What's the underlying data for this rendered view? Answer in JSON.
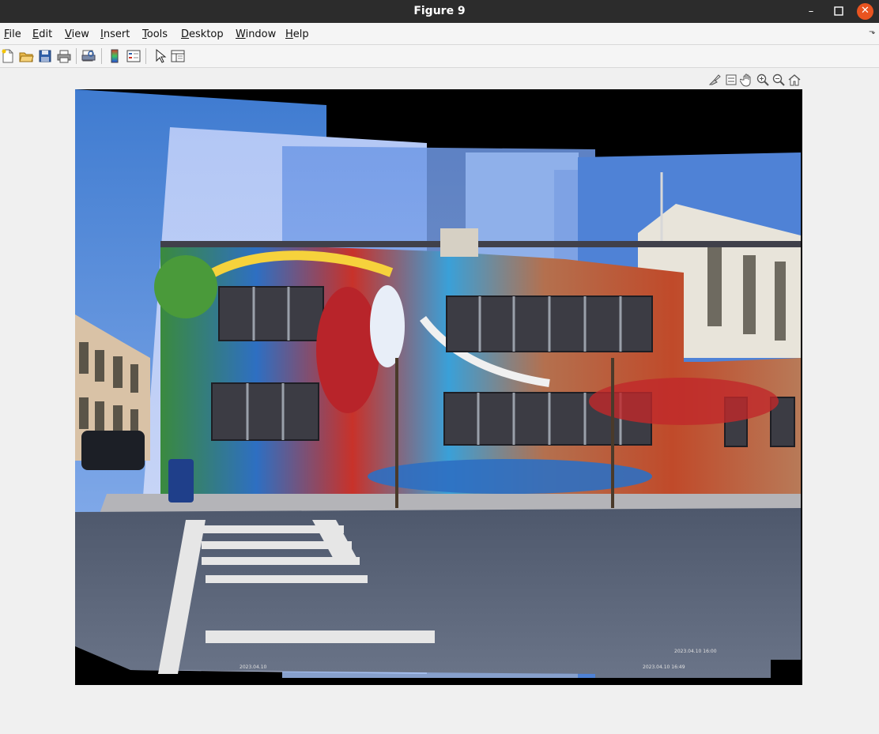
{
  "window": {
    "title": "Figure 9",
    "minimize_glyph": "–",
    "maximize_glyph": "☐",
    "close_glyph": "✕"
  },
  "menu": [
    {
      "key": "F",
      "rest": "ile"
    },
    {
      "key": "E",
      "rest": "dit"
    },
    {
      "key": "V",
      "rest": "iew"
    },
    {
      "key": "I",
      "rest": "nsert"
    },
    {
      "key": "T",
      "rest": "ools"
    },
    {
      "key": "D",
      "rest": "esktop"
    },
    {
      "key": "W",
      "rest": "indow"
    },
    {
      "key": "H",
      "rest": "elp"
    }
  ],
  "menu_dock_glyph": "⬎",
  "toolbar_icons": [
    "new-figure-icon",
    "open-file-icon",
    "save-icon",
    "print-icon",
    "print-preview-icon",
    "insert-colorbar-icon",
    "insert-legend-icon",
    "edit-plot-arrow-icon",
    "property-inspector-icon"
  ],
  "axes_toolbar_icons": [
    "brush-icon",
    "data-tips-icon",
    "pan-hand-icon",
    "zoom-in-icon",
    "zoom-out-icon",
    "restore-view-home-icon"
  ],
  "image": {
    "description_free": true,
    "timestamps": [
      "2023.04.10 16:00",
      "2023.04.10 16:49",
      "2023.04.10"
    ],
    "colors": {
      "sky_top": "#3f7bd0",
      "sky_light": "#a8c0f0",
      "road": "#5a6478",
      "mural_red": "#c8322a",
      "brick": "#b4704e"
    }
  }
}
